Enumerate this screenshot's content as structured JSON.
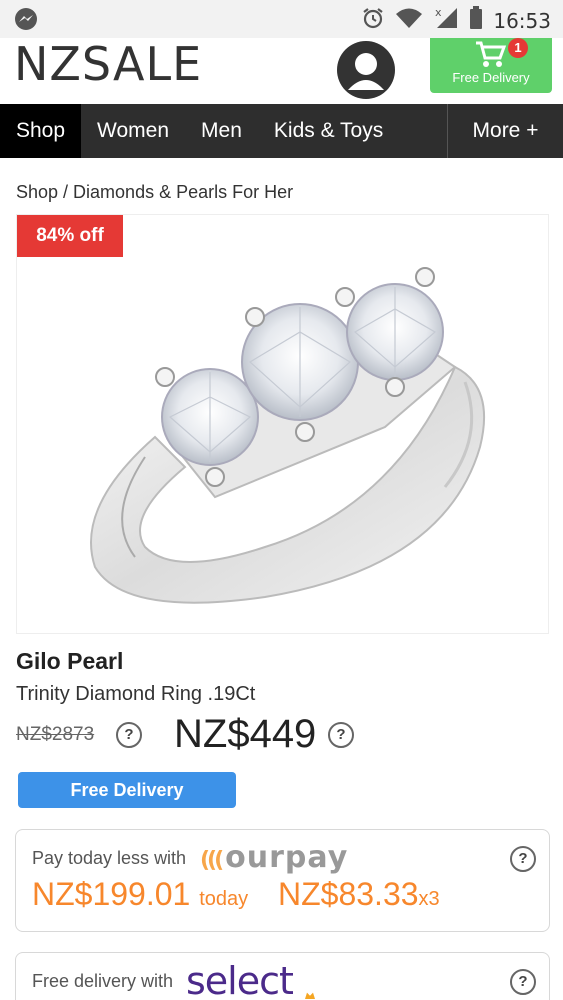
{
  "status_bar": {
    "time": "16:53"
  },
  "header": {
    "logo": "NZSALE",
    "cart_count": "1",
    "cart_label": "Free Delivery"
  },
  "nav": {
    "items": [
      "Shop",
      "Women",
      "Men",
      "Kids & Toys"
    ],
    "more": "More +"
  },
  "breadcrumb": "Shop / Diamonds & Pearls For Her",
  "product": {
    "discount": "84% off",
    "brand": "Gilo Pearl",
    "name": "Trinity Diamond Ring .19Ct",
    "old_price": "NZ$2873",
    "price": "NZ$449",
    "help_glyph": "?",
    "free_delivery": "Free Delivery"
  },
  "ourpay": {
    "label": "Pay today less with",
    "logo": "ourpay",
    "today_amount": "NZ$199.01",
    "today_word": "today",
    "installment_amount": "NZ$83.33",
    "installment_times": "x3"
  },
  "select": {
    "label": "Free delivery with",
    "logo": "select"
  },
  "colors": {
    "nav_bg": "#2e2e2e",
    "cart_green": "#5fd06a",
    "discount_red": "#e53935",
    "delivery_blue": "#3d92e8",
    "ourpay_orange": "#f7872c",
    "select_purple": "#4b2a8a"
  }
}
